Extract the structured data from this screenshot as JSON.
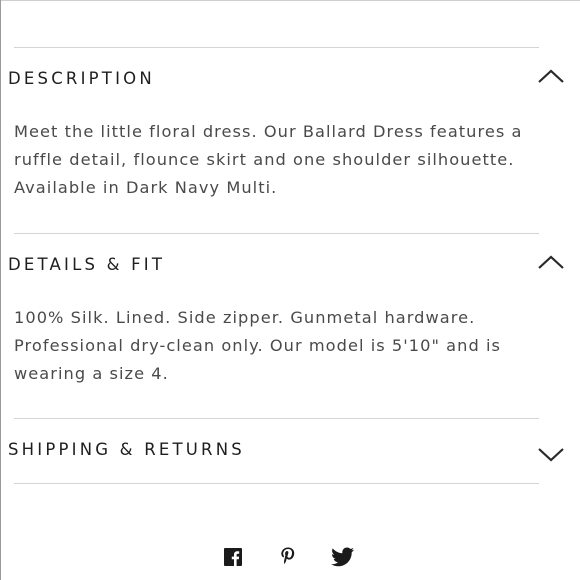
{
  "sections": [
    {
      "title": "DESCRIPTION",
      "expanded": true,
      "chevron_icon": "chevron-up-icon",
      "body": "Meet the little floral dress. Our Ballard Dress features a ruffle detail, flounce skirt and one shoulder silhouette. Available in Dark Navy Multi."
    },
    {
      "title": "DETAILS & FIT",
      "expanded": true,
      "chevron_icon": "chevron-up-icon",
      "body": "100% Silk. Lined. Side zipper. Gunmetal hardware. Professional dry-clean only. Our model is 5'10\" and is wearing a size 4."
    },
    {
      "title": "SHIPPING & RETURNS",
      "expanded": false,
      "chevron_icon": "chevron-down-icon",
      "body": ""
    }
  ],
  "share_icons": [
    "facebook-icon",
    "pinterest-icon",
    "twitter-icon"
  ],
  "colors": {
    "text": "#1e1e1e",
    "body_text": "#4a4a4a",
    "divider": "#d4d4d4",
    "icon": "#1a1a1a"
  }
}
